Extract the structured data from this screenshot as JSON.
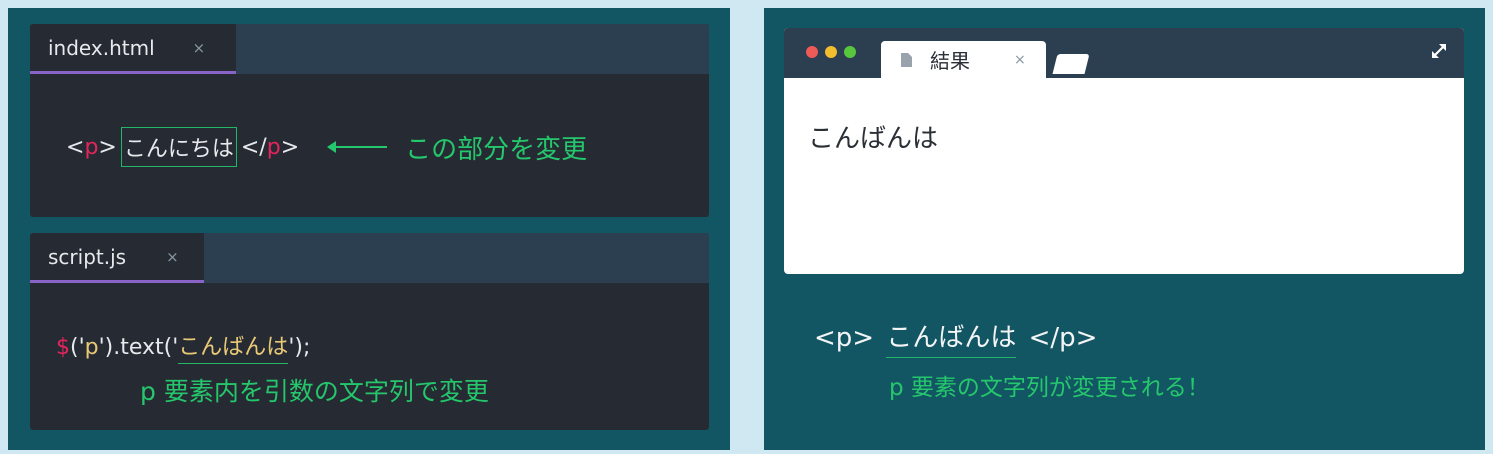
{
  "colors": {
    "page_bg": "#cfe8f2",
    "panel_bg": "#135663",
    "editor_bg": "#262b33",
    "tabbar_bg": "#2b3f51",
    "tab_indicator": "#8a63c9",
    "tag_red": "#e5245c",
    "string_yellow": "#e9c975",
    "accent_green": "#25c76c"
  },
  "html_editor": {
    "tab_label": "index.html",
    "tab_close": "×",
    "code": {
      "open_lt": "<",
      "open_tag": "p",
      "open_gt": ">",
      "content": "こんにちは",
      "close_lt": "</",
      "close_tag": "p",
      "close_gt": ">"
    },
    "annotation": "この部分を変更",
    "arrow_icon": "left-arrow-icon"
  },
  "js_editor": {
    "tab_label": "script.js",
    "tab_close": "×",
    "code": {
      "dollar": "$",
      "selector_prefix": "('",
      "selector": "p",
      "selector_suffix": "').text('",
      "argument": "こんばんは",
      "suffix": "');"
    },
    "annotation": "p 要素内を引数の文字列で変更"
  },
  "browser": {
    "window_dots": [
      "red",
      "yellow",
      "green"
    ],
    "tab_icon": "document-icon",
    "tab_title": "結果",
    "tab_close": "×",
    "expand_icon": "expand-icon",
    "content_text": "こんばんは"
  },
  "result": {
    "open_tag": "<p>",
    "text": "こんばんは",
    "close_tag": "</p>",
    "annotation": "p 要素の文字列が変更される！"
  }
}
